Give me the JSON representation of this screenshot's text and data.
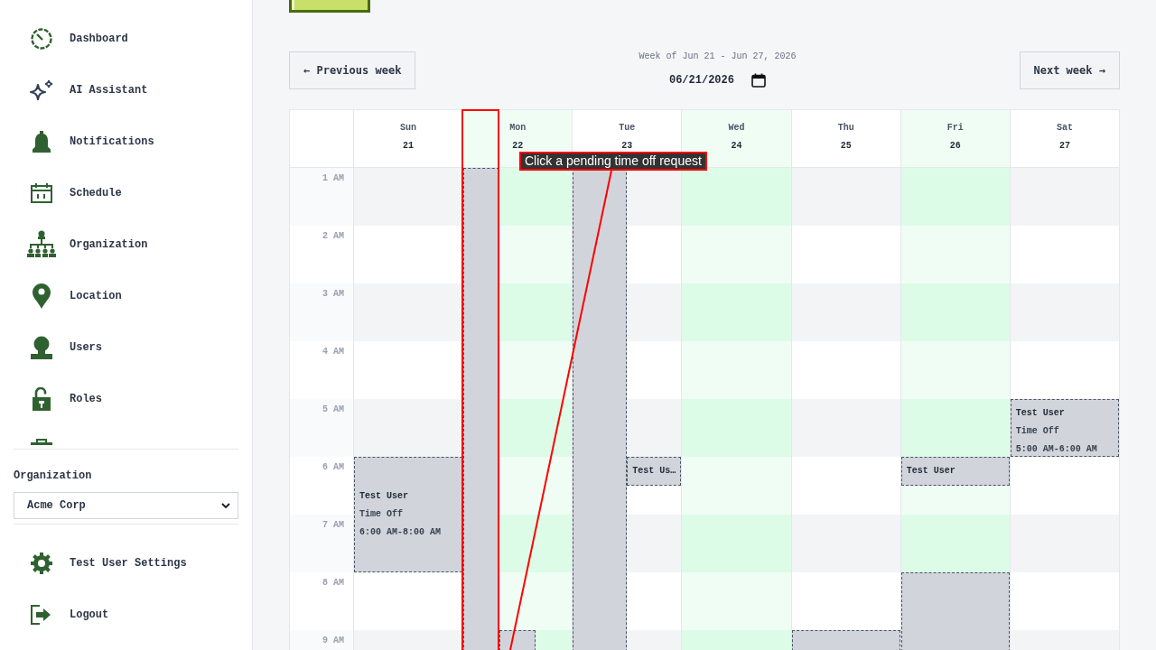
{
  "sidebar": {
    "nav_items": [
      "Dashboard",
      "AI Assistant",
      "Notifications",
      "Schedule",
      "Organization",
      "Location",
      "Users",
      "Roles"
    ],
    "organization": {
      "label": "Organization",
      "value": "Acme Corp"
    },
    "footer_items": [
      "Test User Settings",
      "Logout"
    ]
  },
  "toolbar": {
    "previous_button": "← Previous week",
    "week_label": "Week of Jun 21 - Jun 27, 2026",
    "date_value": "06/21/2026",
    "next_button": "Next week →"
  },
  "calendar": {
    "days": [
      {
        "name": "Sun",
        "date": "21",
        "highlighted": false
      },
      {
        "name": "Mon",
        "date": "22",
        "highlighted": true
      },
      {
        "name": "Tue",
        "date": "23",
        "highlighted": false
      },
      {
        "name": "Wed",
        "date": "24",
        "highlighted": true
      },
      {
        "name": "Thu",
        "date": "25",
        "highlighted": false
      },
      {
        "name": "Fri",
        "date": "26",
        "highlighted": true
      },
      {
        "name": "Sat",
        "date": "27",
        "highlighted": false
      }
    ],
    "rows": [
      {
        "label": "1 AM",
        "cells": [
          {},
          {
            "events": [
              {
                "kind": "third1_open"
              }
            ]
          },
          {
            "events": [
              {
                "kind": "half1_open"
              }
            ]
          },
          {},
          {},
          {},
          {}
        ]
      },
      {
        "label": "2 AM",
        "cells": [
          {},
          {},
          {},
          {},
          {},
          {},
          {}
        ]
      },
      {
        "label": "3 AM",
        "cells": [
          {},
          {},
          {},
          {},
          {},
          {},
          {}
        ]
      },
      {
        "label": "4 AM",
        "cells": [
          {},
          {},
          {},
          {},
          {},
          {},
          {}
        ]
      },
      {
        "label": "5 AM",
        "cells": [
          {},
          {},
          {},
          {},
          {},
          {},
          {
            "events": [
              {
                "kind": "full_hour",
                "title": "Test User",
                "type": "Time Off",
                "time": "5:00 AM-6:00 AM"
              }
            ]
          }
        ]
      },
      {
        "label": "6 AM",
        "cells": [
          {
            "events": [
              {
                "kind": "full_twohours",
                "title": "Test User",
                "type": "Time Off",
                "time": "6:00 AM-8:00 AM"
              }
            ]
          },
          {},
          {
            "events": [
              {
                "kind": "half2_halfhour",
                "title": "Test Us…"
              }
            ]
          },
          {},
          {},
          {
            "events": [
              {
                "kind": "full_halfhour",
                "title": "Test User"
              }
            ]
          },
          {}
        ]
      },
      {
        "label": "7 AM",
        "cells": [
          {},
          {},
          {},
          {},
          {},
          {},
          {}
        ]
      },
      {
        "label": "8 AM",
        "cells": [
          {},
          {},
          {},
          {},
          {},
          {
            "events": [
              {
                "kind": "full_open"
              }
            ]
          },
          {}
        ]
      },
      {
        "label": "9 AM",
        "cells": [
          {},
          {
            "events": [
              {
                "kind": "third2_open"
              }
            ]
          },
          {},
          {},
          {
            "events": [
              {
                "kind": "full_open"
              }
            ]
          },
          {},
          {}
        ]
      }
    ]
  },
  "annotation": {
    "tooltip": "Click a pending time off request"
  }
}
